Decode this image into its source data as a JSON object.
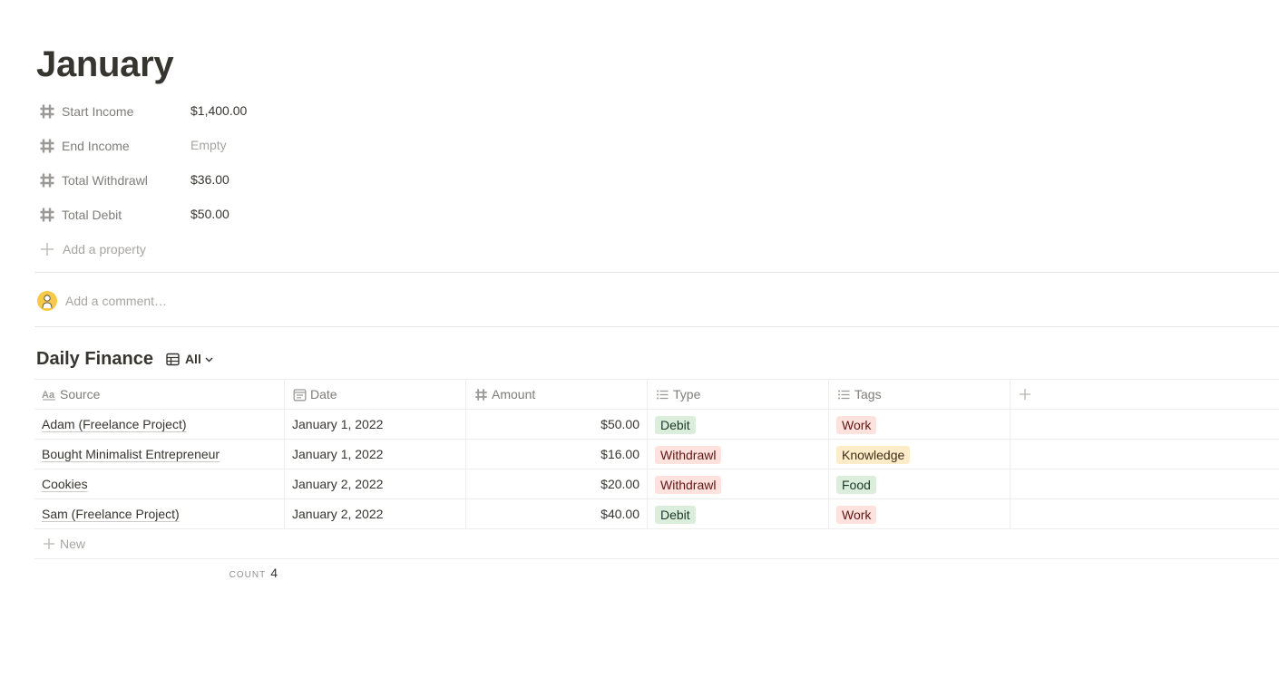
{
  "page": {
    "title": "January"
  },
  "properties": [
    {
      "label": "Start Income",
      "value": "$1,400.00",
      "icon": "number-hash-icon"
    },
    {
      "label": "End Income",
      "value": "Empty",
      "icon": "number-hash-icon"
    },
    {
      "label": "Total Withdrawl",
      "value": "$36.00",
      "icon": "number-hash-icon"
    },
    {
      "label": "Total Debit",
      "value": "$50.00",
      "icon": "number-hash-icon"
    }
  ],
  "add_property": {
    "label": "Add a property"
  },
  "comment": {
    "placeholder": "Add a comment…"
  },
  "database": {
    "title": "Daily Finance",
    "view_label": "All",
    "columns": [
      {
        "label": "Source",
        "icon": "text-aa-icon"
      },
      {
        "label": "Date",
        "icon": "calendar-icon"
      },
      {
        "label": "Amount",
        "icon": "number-hash-icon"
      },
      {
        "label": "Type",
        "icon": "list-icon"
      },
      {
        "label": "Tags",
        "icon": "list-icon"
      }
    ],
    "rows": [
      {
        "source": "Adam (Freelance Project)",
        "date": "January 1, 2022",
        "amount": "$50.00",
        "type": "Debit",
        "tags": "Work"
      },
      {
        "source": "Bought Minimalist Entrepreneur",
        "date": "January 1, 2022",
        "amount": "$16.00",
        "type": "Withdrawl",
        "tags": "Knowledge"
      },
      {
        "source": "Cookies",
        "date": "January 2, 2022",
        "amount": "$20.00",
        "type": "Withdrawl",
        "tags": "Food"
      },
      {
        "source": "Sam (Freelance Project)",
        "date": "January 2, 2022",
        "amount": "$40.00",
        "type": "Debit",
        "tags": "Work"
      }
    ],
    "new_label": "New",
    "count_label": "COUNT",
    "count_value": "4"
  },
  "tag_colors": {
    "Debit": {
      "bg": "#dbeddb",
      "fg": "#1c3829"
    },
    "Withdrawl": {
      "bg": "#ffe2dd",
      "fg": "#5d1715"
    },
    "Work": {
      "bg": "#ffe2dd",
      "fg": "#5d1715"
    },
    "Knowledge": {
      "bg": "#fdecc8",
      "fg": "#402c1b"
    },
    "Food": {
      "bg": "#dbeddb",
      "fg": "#1c3829"
    }
  }
}
